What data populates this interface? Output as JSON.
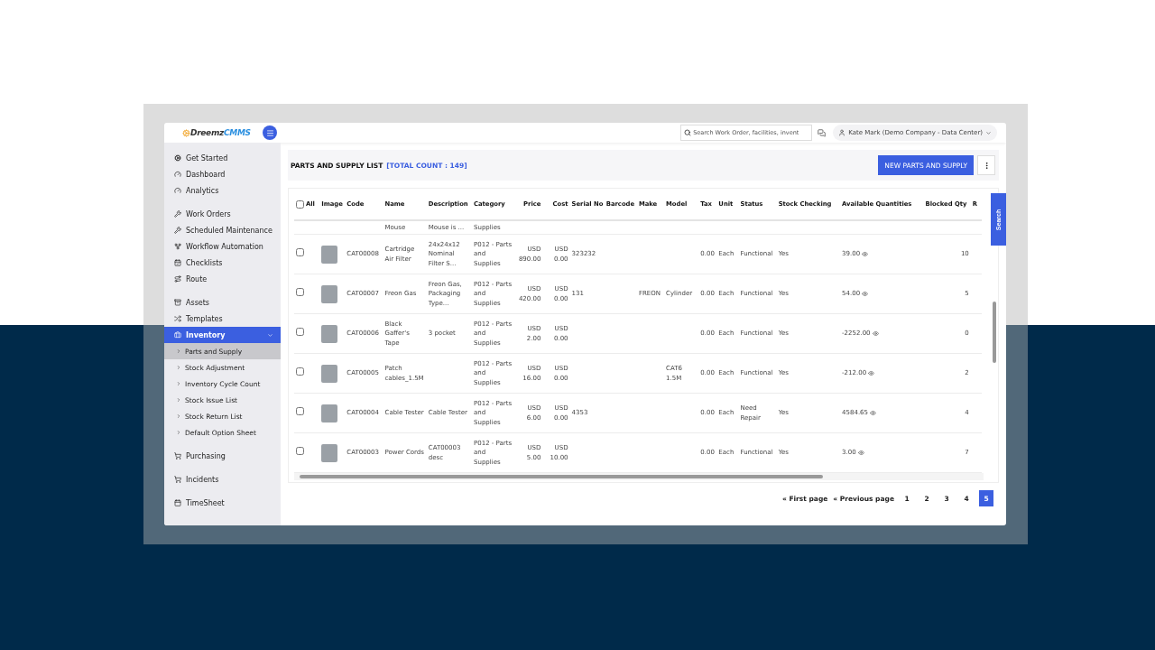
{
  "header": {
    "logo": {
      "brand": "Dreemz",
      "suffix": "CMMS"
    },
    "search": {
      "placeholder": "Search Work Order, facilities, invent"
    },
    "user": "Kate Mark (Demo Company - Data Center)"
  },
  "sidebar": {
    "groups": [
      [
        {
          "label": "Get Started",
          "selected": false
        },
        {
          "label": "Dashboard",
          "selected": false
        },
        {
          "label": "Analytics",
          "selected": false
        }
      ],
      [
        {
          "label": "Work Orders",
          "selected": false
        },
        {
          "label": "Scheduled Maintenance",
          "selected": false
        },
        {
          "label": "Workflow Automation",
          "selected": false
        },
        {
          "label": "Checklists",
          "selected": false
        },
        {
          "label": "Route",
          "selected": false
        }
      ],
      [
        {
          "label": "Assets",
          "selected": false
        },
        {
          "label": "Templates",
          "selected": false
        },
        {
          "label": "Inventory",
          "selected": true,
          "expanded": true,
          "children": [
            {
              "label": "Parts and Supply",
              "selected": true
            },
            {
              "label": "Stock Adjustment",
              "selected": false
            },
            {
              "label": "Inventory Cycle Count",
              "selected": false
            },
            {
              "label": "Stock Issue List",
              "selected": false
            },
            {
              "label": "Stock Return List",
              "selected": false
            },
            {
              "label": "Default Option Sheet",
              "selected": false
            }
          ]
        }
      ],
      [
        {
          "label": "Purchasing",
          "selected": false
        }
      ],
      [
        {
          "label": "Incidents",
          "selected": false
        }
      ],
      [
        {
          "label": "TimeSheet",
          "selected": false
        }
      ]
    ]
  },
  "page": {
    "title": "PARTS AND SUPPLY LIST",
    "count": "[TOTAL COUNT : 149]",
    "new_button": "NEW PARTS AND SUPPLY"
  },
  "table": {
    "select_all": {
      "label": "All",
      "checked": false
    },
    "columns": [
      "Image",
      "Code",
      "Name",
      "Description",
      "Category",
      "Price",
      "Cost",
      "Serial No",
      "Barcode",
      "Make",
      "Model",
      "Tax",
      "Unit",
      "Status",
      "Stock Checking",
      "Available Quantities",
      "Blocked Qty",
      "R"
    ],
    "clipped_row": {
      "name": "Mouse",
      "description": "Mouse is ...",
      "category": "Supplies"
    },
    "rows": [
      {
        "checked": false,
        "code": "CAT00008",
        "name": "Cartridge Air Filter",
        "description": "24x24x12 Nominal Filter S...",
        "category": "P012 - Parts and Supplies",
        "price": "USD 890.00",
        "cost": "USD 0.00",
        "serial": "323232",
        "barcode": "",
        "make": "",
        "model": "",
        "tax": "0.00",
        "unit": "Each",
        "status": "Functional",
        "stock_checking": "Yes",
        "available": "39.00",
        "blocked": "10"
      },
      {
        "checked": false,
        "code": "CAT00007",
        "name": "Freon Gas",
        "description": "Freon Gas, Packaging Type...",
        "category": "P012 - Parts and Supplies",
        "price": "USD 420.00",
        "cost": "USD 0.00",
        "serial": "131",
        "barcode": "",
        "make": "FREON",
        "model": "Cylinder",
        "tax": "0.00",
        "unit": "Each",
        "status": "Functional",
        "stock_checking": "Yes",
        "available": "54.00",
        "blocked": "5"
      },
      {
        "checked": false,
        "code": "CAT00006",
        "name": "Black Gaffer's Tape",
        "description": "3 pocket",
        "category": "P012 - Parts and Supplies",
        "price": "USD 2.00",
        "cost": "USD 0.00",
        "serial": "",
        "barcode": "",
        "make": "",
        "model": "",
        "tax": "0.00",
        "unit": "Each",
        "status": "Functional",
        "stock_checking": "Yes",
        "available": "-2252.00",
        "blocked": "0"
      },
      {
        "checked": false,
        "code": "CAT00005",
        "name": "Patch cables_1.5M",
        "description": "",
        "category": "P012 - Parts and Supplies",
        "price": "USD 16.00",
        "cost": "USD 0.00",
        "serial": "",
        "barcode": "",
        "make": "",
        "model": "CAT6 1.5M",
        "tax": "0.00",
        "unit": "Each",
        "status": "Functional",
        "stock_checking": "Yes",
        "available": "-212.00",
        "blocked": "2"
      },
      {
        "checked": false,
        "code": "CAT00004",
        "name": "Cable Tester",
        "description": "Cable Tester",
        "category": "P012 - Parts and Supplies",
        "price": "USD 6.00",
        "cost": "USD 0.00",
        "serial": "4353",
        "barcode": "",
        "make": "",
        "model": "",
        "tax": "0.00",
        "unit": "Each",
        "status": "Need Repair",
        "stock_checking": "Yes",
        "available": "4584.65",
        "blocked": "4"
      },
      {
        "checked": false,
        "code": "CAT00003",
        "name": "Power Cords",
        "description": "CAT00003 desc",
        "category": "P012 - Parts and Supplies",
        "price": "USD 5.00",
        "cost": "USD 10.00",
        "serial": "",
        "barcode": "",
        "make": "",
        "model": "",
        "tax": "0.00",
        "unit": "Each",
        "status": "Functional",
        "stock_checking": "Yes",
        "available": "3.00",
        "blocked": "7"
      }
    ]
  },
  "pagination": {
    "first": "« First page",
    "previous": "« Previous page",
    "pages": [
      {
        "label": "1",
        "selected": false
      },
      {
        "label": "2",
        "selected": false
      },
      {
        "label": "3",
        "selected": false
      },
      {
        "label": "4",
        "selected": false
      },
      {
        "label": "5",
        "selected": true
      }
    ]
  },
  "search_tab": "Search"
}
